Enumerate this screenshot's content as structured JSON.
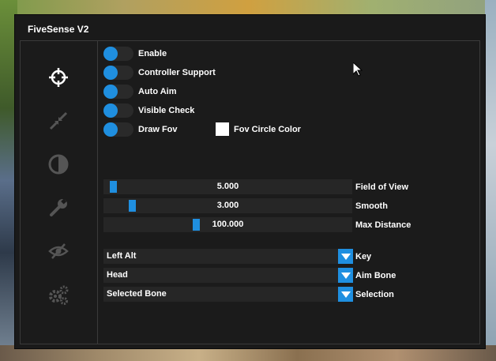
{
  "window": {
    "title": "FiveSense V2"
  },
  "sidebar": {
    "icons": [
      "crosshair-icon",
      "shrink-icon",
      "contrast-icon",
      "wrench-icon",
      "eye-slash-icon",
      "gears-icon"
    ]
  },
  "toggles": [
    {
      "label": "Enable",
      "on": true
    },
    {
      "label": "Controller Support",
      "on": true
    },
    {
      "label": "Auto Aim",
      "on": true
    },
    {
      "label": "Visible Check",
      "on": true
    },
    {
      "label": "Draw Fov",
      "on": true
    }
  ],
  "fov_color": {
    "label": "Fov Circle Color",
    "color": "#ffffff"
  },
  "sliders": [
    {
      "value": "5.000",
      "label": "Field of View"
    },
    {
      "value": "3.000",
      "label": "Smooth"
    },
    {
      "value": "100.000",
      "label": "Max Distance"
    }
  ],
  "combos": [
    {
      "value": "Left Alt",
      "label": "Key"
    },
    {
      "value": "Head",
      "label": "Aim Bone"
    },
    {
      "value": "Selected Bone",
      "label": "Selection"
    }
  ],
  "colors": {
    "accent": "#1f8fe0",
    "panel": "#1b1b1b",
    "control": "#262626"
  }
}
